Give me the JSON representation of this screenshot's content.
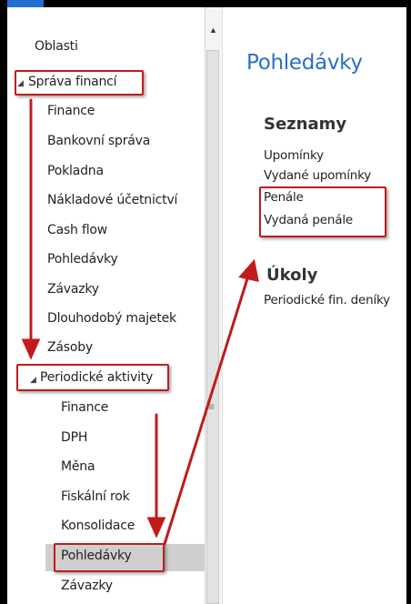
{
  "navigation": {
    "header": "Oblasti",
    "items": [
      {
        "label": "Správa financí",
        "level": 0,
        "expanded": true
      },
      {
        "label": "Finance",
        "level": 1
      },
      {
        "label": "Bankovní správa",
        "level": 1
      },
      {
        "label": "Pokladna",
        "level": 1
      },
      {
        "label": "Nákladové účetnictví",
        "level": 1
      },
      {
        "label": "Cash flow",
        "level": 1
      },
      {
        "label": "Pohledávky",
        "level": 1
      },
      {
        "label": "Závazky",
        "level": 1
      },
      {
        "label": "Dlouhodobý majetek",
        "level": 1
      },
      {
        "label": "Zásoby",
        "level": 1
      },
      {
        "label": "Periodické aktivity",
        "level": 1,
        "expanded": true
      },
      {
        "label": "Finance",
        "level": 2
      },
      {
        "label": "DPH",
        "level": 2
      },
      {
        "label": "Měna",
        "level": 2
      },
      {
        "label": "Fiskální rok",
        "level": 2
      },
      {
        "label": "Konsolidace",
        "level": 2
      },
      {
        "label": "Pohledávky",
        "level": 2,
        "selected": true
      },
      {
        "label": "Závazky",
        "level": 2
      }
    ]
  },
  "content": {
    "title": "Pohledávky",
    "groups": [
      {
        "title": "Seznamy",
        "links": [
          "Upomínky",
          "Vydané upomínky",
          "Penále",
          "Vydaná penále"
        ]
      },
      {
        "title": "Úkoly",
        "links": [
          "Periodické fin. deníky"
        ]
      }
    ]
  },
  "icons": {
    "expand": "triangle-expanded-icon",
    "scroll_up": "scroll-up-icon",
    "grip": "splitter-grip-icon"
  },
  "colors": {
    "title_blue": "#2a6fc9",
    "highlight_red": "#c11b1b",
    "selected_bg": "#cfcfcf"
  }
}
